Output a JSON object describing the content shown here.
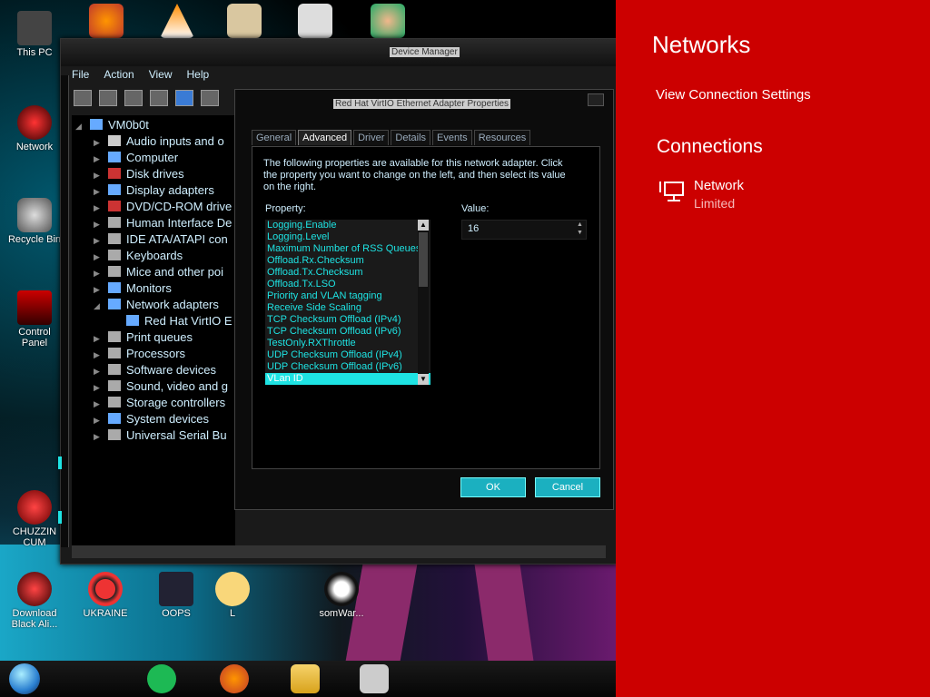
{
  "desktop": {
    "top_icons": [
      "firefox-icon",
      "vlc-icon",
      "hxd-icon",
      "app-icon",
      "user-icon"
    ],
    "icons": [
      {
        "label": "This PC",
        "icon": "computer-icon"
      },
      {
        "label": "Network",
        "icon": "network-icon"
      },
      {
        "label": "Recycle Bin",
        "icon": "recycle-bin-icon"
      },
      {
        "label": "Control Panel",
        "icon": "control-panel-icon"
      },
      {
        "label": "CHUZZIN CUM",
        "icon": "app-icon"
      },
      {
        "label": "Download Black Ali...",
        "icon": "download-icon"
      },
      {
        "label": "UKRAINE",
        "icon": "radiation-icon"
      },
      {
        "label": "OOPS",
        "icon": "app-icon"
      },
      {
        "label": "L",
        "icon": "app-icon"
      },
      {
        "label": "somWar...",
        "icon": "skull-icon"
      }
    ]
  },
  "device_manager": {
    "title": "Device Manager",
    "menu": [
      "File",
      "Action",
      "View",
      "Help"
    ],
    "tree": {
      "root": "VM0b0t",
      "items": [
        "Audio inputs and o",
        "Computer",
        "Disk drives",
        "Display adapters",
        "DVD/CD-ROM drive",
        "Human Interface De",
        "IDE ATA/ATAPI con",
        "Keyboards",
        "Mice and other poi",
        "Monitors",
        "Network adapters",
        "Red Hat VirtIO E",
        "Print queues",
        "Processors",
        "Software devices",
        "Sound, video and g",
        "Storage controllers",
        "System devices",
        "Universal Serial Bu"
      ]
    }
  },
  "properties_dialog": {
    "title": "Red Hat VirtIO Ethernet Adapter Properties",
    "tabs": [
      "General",
      "Advanced",
      "Driver",
      "Details",
      "Events",
      "Resources"
    ],
    "active_tab": "Advanced",
    "description": "The following properties are available for this network adapter. Click the property you want to change on the left, and then select its value on the right.",
    "property_label": "Property:",
    "value_label": "Value:",
    "properties": [
      "Logging.Enable",
      "Logging.Level",
      "Maximum Number of RSS Queues",
      "Offload.Rx.Checksum",
      "Offload.Tx.Checksum",
      "Offload.Tx.LSO",
      "Priority and VLAN tagging",
      "Receive Side Scaling",
      "TCP Checksum Offload (IPv4)",
      "TCP Checksum Offload (IPv6)",
      "TestOnly.RXThrottle",
      "UDP Checksum Offload (IPv4)",
      "UDP Checksum Offload (IPv6)",
      "VLan ID"
    ],
    "selected_property": "VLan ID",
    "value": "16",
    "ok_label": "OK",
    "cancel_label": "Cancel"
  },
  "taskbar": {
    "items": [
      "start-orb",
      "spotify-icon",
      "firefox-icon",
      "file-explorer-icon",
      "device-manager-icon"
    ]
  },
  "networks_pane": {
    "title": "Networks",
    "view_settings": "View Connection Settings",
    "connections_heading": "Connections",
    "network_name": "Network",
    "network_status": "Limited",
    "accent_color": "#cc0000"
  }
}
